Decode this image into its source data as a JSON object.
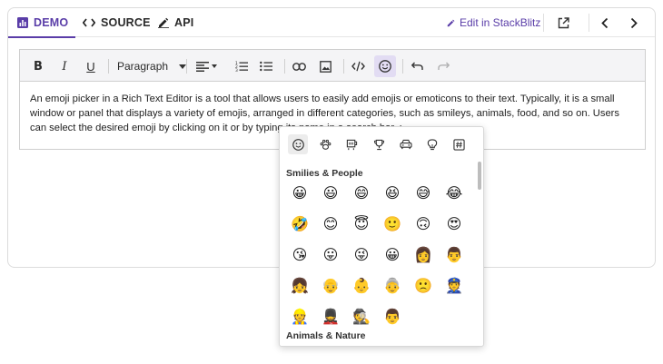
{
  "tabs": [
    {
      "label": "DEMO",
      "icon": "chart-icon"
    },
    {
      "label": "SOURCE",
      "icon": "code-icon"
    },
    {
      "label": "API",
      "icon": "pencil-icon"
    }
  ],
  "header": {
    "edit_label": "Edit in StackBlitz",
    "icons": [
      "open-new-window-icon",
      "chevron-left-icon",
      "chevron-right-icon"
    ]
  },
  "toolbar": {
    "bold": "B",
    "italic": "I",
    "underline": "U",
    "format_selected": "Paragraph"
  },
  "editor": {
    "content": "An emoji picker in a Rich Text Editor is a tool that allows users to easily add emojis or emoticons to their text. Typically, it is a small window or panel that displays a variety of emojis, arranged in different categories, such as smileys, animals, food, and so on. Users can select the desired emoji by clicking on it or by typing its name in a search bar. :"
  },
  "picker": {
    "categories": [
      "smiley-icon",
      "paw-icon",
      "food-icon",
      "trophy-icon",
      "car-icon",
      "lightbulb-icon",
      "symbols-icon"
    ],
    "sections": [
      {
        "title": "Smilies & People",
        "emojis": [
          "😀",
          "😃",
          "😄",
          "😆",
          "😅",
          "😂",
          "🤣",
          "😊",
          "😇",
          "🙂",
          "🙃",
          "😍",
          "😘",
          "😛",
          "😜",
          "😀",
          "👩",
          "👨",
          "👧",
          "👴",
          "👶",
          "👵",
          "🙁",
          "👮",
          "👷",
          "💂",
          "🕵",
          "👨"
        ]
      },
      {
        "title": "Animals & Nature"
      }
    ]
  },
  "colors": {
    "accent": "#5a3da8",
    "toolbar_bg": "#f4f4f6",
    "active_bg": "#e2dcf3"
  }
}
